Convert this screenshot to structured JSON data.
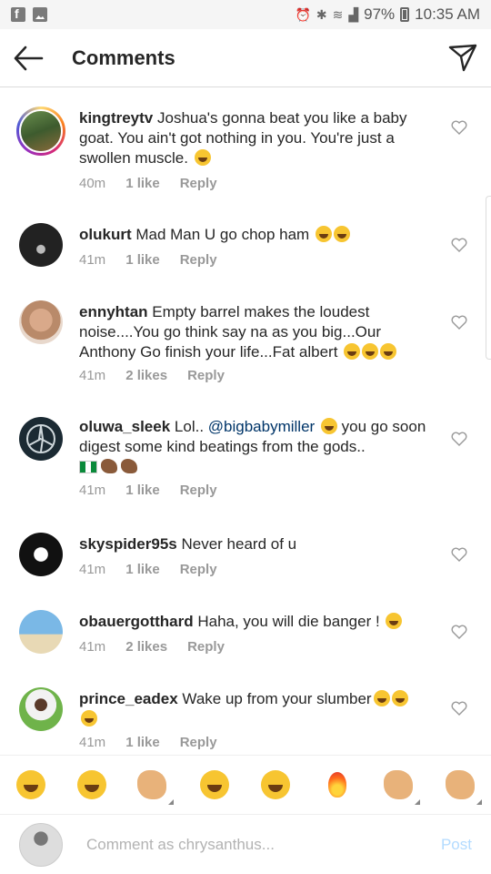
{
  "status_bar": {
    "battery": "97%",
    "time": "10:35 AM",
    "icons": [
      "facebook-icon",
      "gallery-icon",
      "alarm-icon",
      "bluetooth-icon",
      "wifi-icon",
      "signal-icon",
      "battery-icon"
    ]
  },
  "header": {
    "title": "Comments",
    "back_icon": "arrow-left-icon",
    "share_icon": "send-icon"
  },
  "comments": [
    {
      "username": "kingtreytv",
      "text": "Joshua's gonna beat you like a baby goat. You ain't got nothing in you. You're just a swollen muscle.",
      "emoji": "😅",
      "time": "40m",
      "likes": "1 like",
      "reply": "Reply"
    },
    {
      "username": "olukurt",
      "text": "Mad Man U go chop ham",
      "emoji": "😅😅",
      "time": "41m",
      "likes": "1 like",
      "reply": "Reply"
    },
    {
      "username": "ennyhtan",
      "text": "Empty barrel makes the loudest noise....You go think say na as you big...Our Anthony Go finish your life...Fat albert",
      "emoji": "😅😅😅",
      "time": "41m",
      "likes": "2 likes",
      "reply": "Reply"
    },
    {
      "username": "oluwa_sleek",
      "text_before": "Lol..",
      "mention": "@bigbabymiller",
      "text_after": "you go soon digest some kind beatings from the gods..",
      "emoji": "🤣",
      "time": "41m",
      "likes": "1 like",
      "reply": "Reply"
    },
    {
      "username": "skyspider95s",
      "text": "Never heard of u",
      "time": "41m",
      "likes": "1 like",
      "reply": "Reply"
    },
    {
      "username": "obauergotthard",
      "text": "Haha, you will die banger !",
      "emoji": "😑",
      "time": "41m",
      "likes": "2 likes",
      "reply": "Reply"
    },
    {
      "username": "prince_eadex",
      "text": "Wake up from your slumber",
      "emoji": "😅😅😅",
      "time": "41m",
      "likes": "1 like",
      "reply": "Reply"
    }
  ],
  "emoji_bar": [
    "🤣",
    "😂",
    "🙆",
    "😁",
    "🙄",
    "🔥",
    "🤙",
    "👌"
  ],
  "composer": {
    "placeholder": "Comment as chrysanthus...",
    "post_label": "Post"
  },
  "colors": {
    "link": "#003569",
    "meta": "#999999",
    "post_disabled": "#b3dbff",
    "story_ring": [
      "#feda75",
      "#fa7e1e",
      "#d62976",
      "#962fbf",
      "#4f5bd5"
    ]
  }
}
